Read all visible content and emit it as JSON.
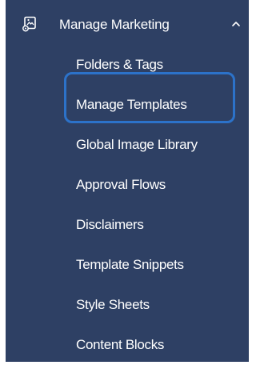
{
  "colors": {
    "panel_background": "#2e4064",
    "text": "#ffffff",
    "focus_ring": "#2c72c9"
  },
  "section": {
    "icon": "marketing-template-icon",
    "label": "Manage Marketing",
    "expanded": true,
    "chevron_icon": "chevron-up-icon"
  },
  "submenu": {
    "items": [
      {
        "label": "Folders & Tags"
      },
      {
        "label": "Manage Templates",
        "focused": true
      },
      {
        "label": "Global Image Library"
      },
      {
        "label": "Approval Flows"
      },
      {
        "label": "Disclaimers"
      },
      {
        "label": "Template Snippets"
      },
      {
        "label": "Style Sheets"
      },
      {
        "label": "Content Blocks"
      }
    ]
  }
}
